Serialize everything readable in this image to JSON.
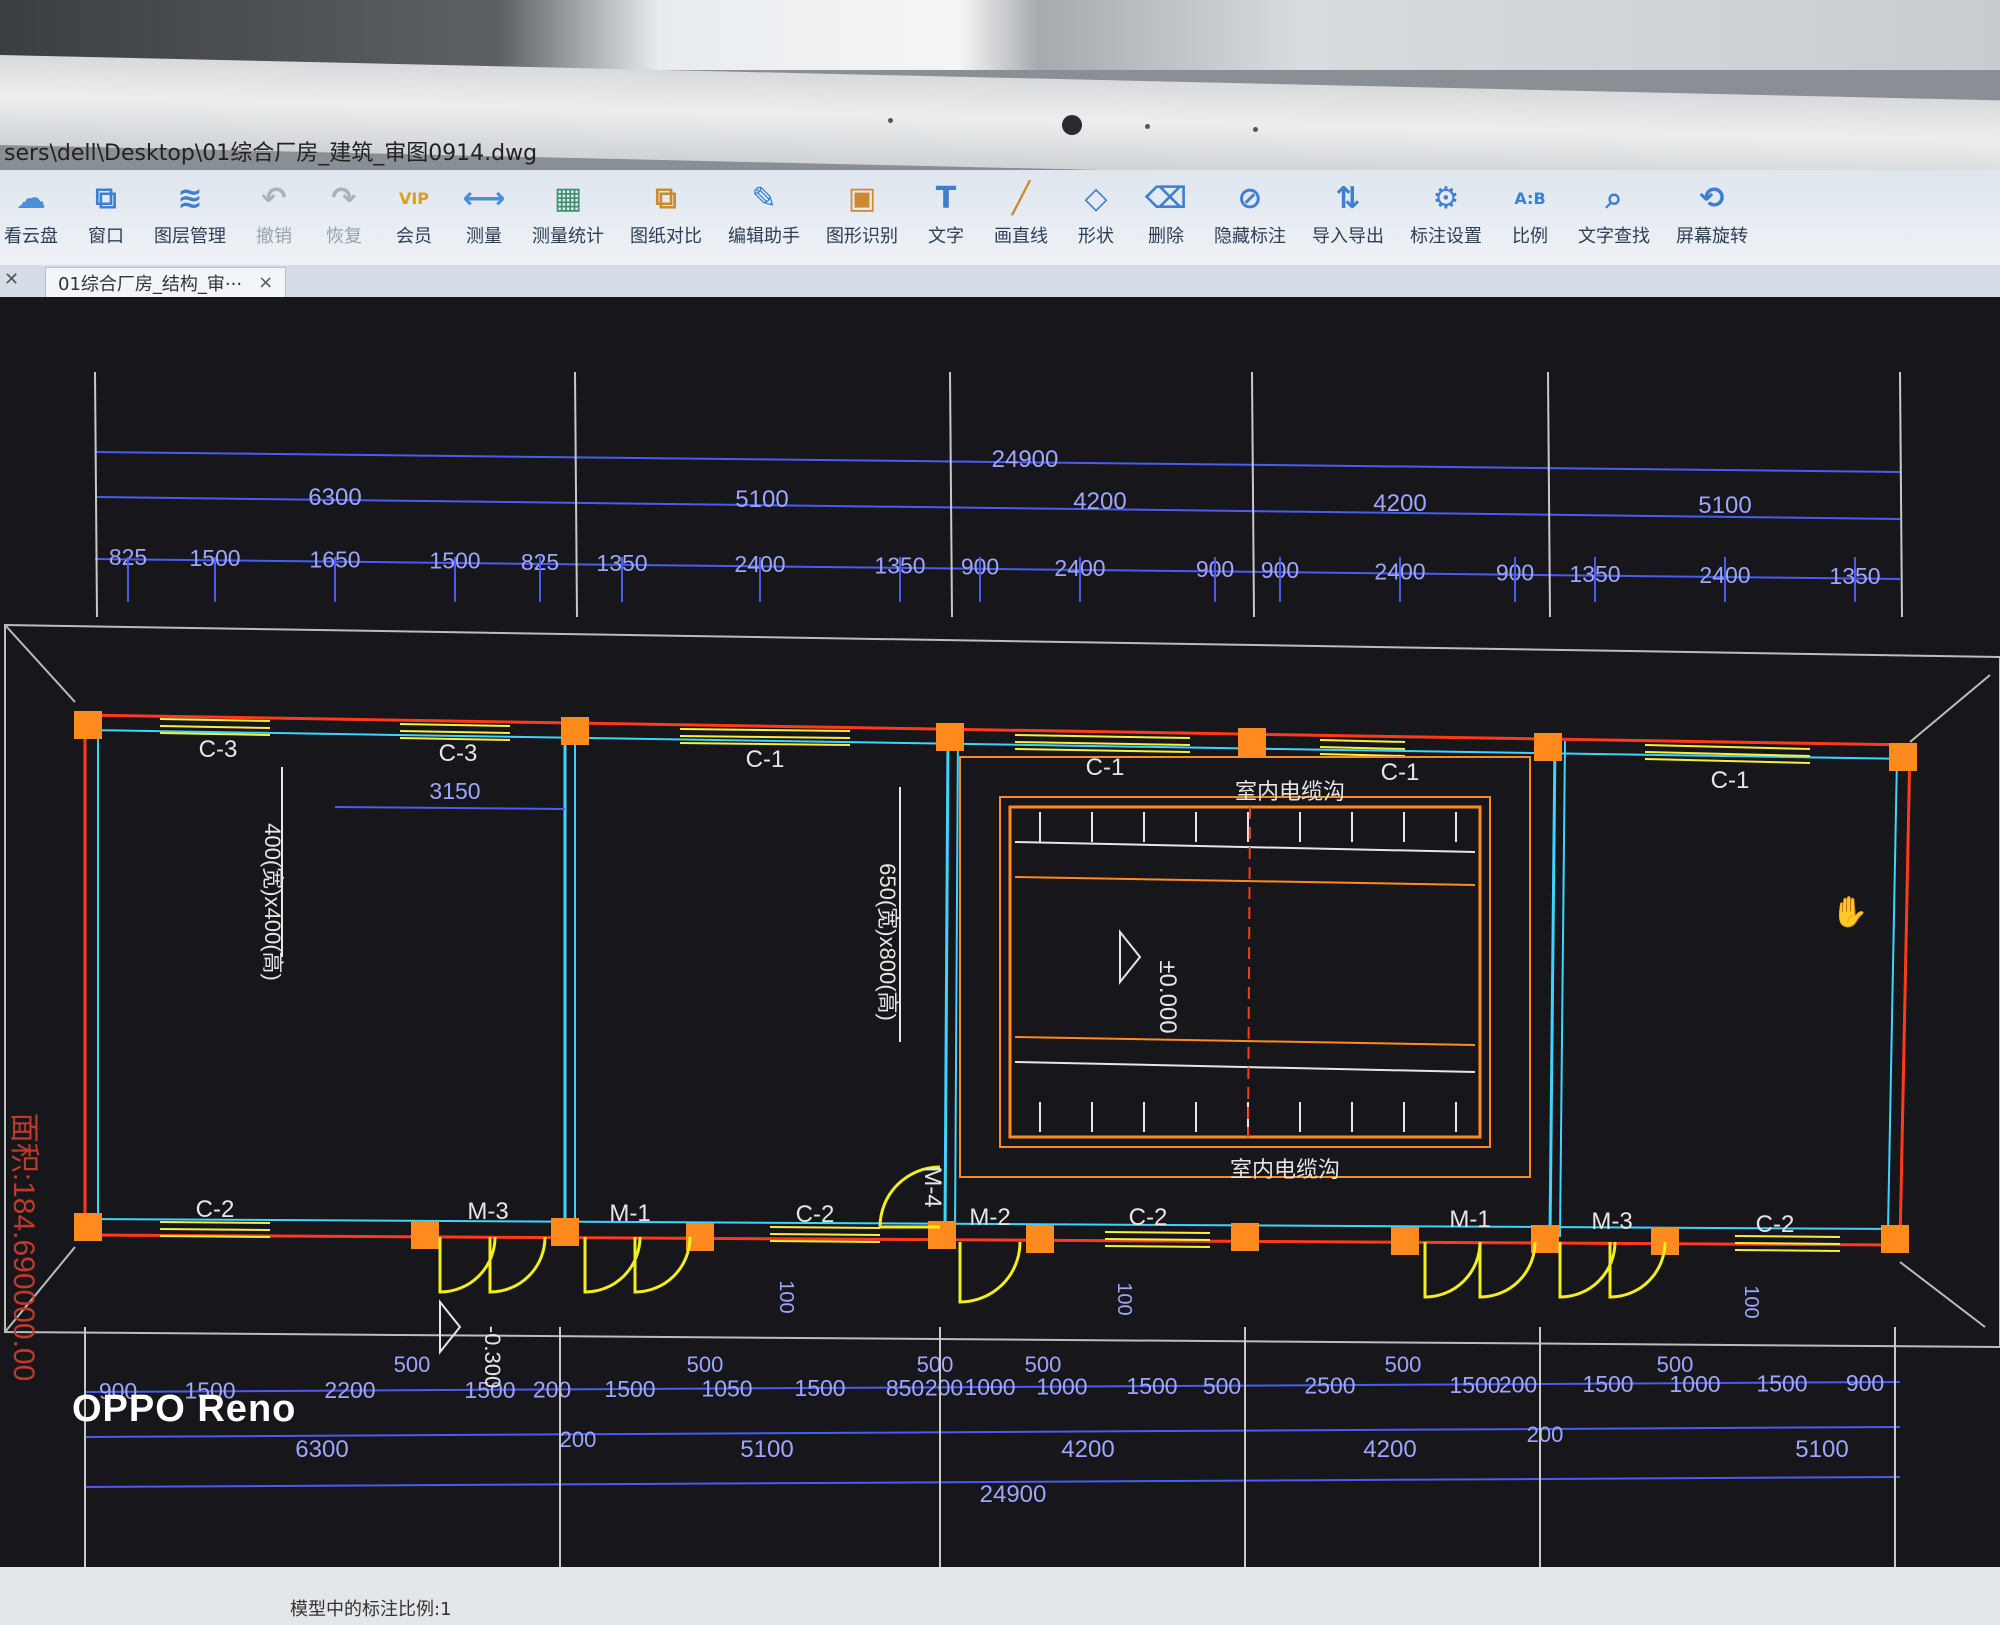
{
  "window": {
    "title_path": "sers\\dell\\Desktop\\01综合厂房_建筑_审图0914.dwg",
    "tab_label": "01综合厂房_结构_审···",
    "tab_close": "×"
  },
  "toolbar": [
    {
      "label": "看云盘",
      "icon": "cloud-icon",
      "color": "#4a8fd8"
    },
    {
      "label": "窗口",
      "icon": "window-icon",
      "color": "#3f7fd1"
    },
    {
      "label": "图层管理",
      "icon": "layers-icon",
      "color": "#3f7fd1"
    },
    {
      "label": "撤销",
      "icon": "undo-icon",
      "color": "#a9b2bc"
    },
    {
      "label": "恢复",
      "icon": "redo-icon",
      "color": "#a9b2bc"
    },
    {
      "label": "会员",
      "icon": "vip-icon",
      "color": "#d6a21c"
    },
    {
      "label": "测量",
      "icon": "measure-icon",
      "color": "#4a8fd8"
    },
    {
      "label": "测量统计",
      "icon": "measure-stats-icon",
      "color": "#3a8f6d"
    },
    {
      "label": "图纸对比",
      "icon": "compare-icon",
      "color": "#c98b2e"
    },
    {
      "label": "编辑助手",
      "icon": "edit-assistant-icon",
      "color": "#2f7fd8"
    },
    {
      "label": "图形识别",
      "icon": "shape-recognize-icon",
      "color": "#c98b2e"
    },
    {
      "label": "文字",
      "icon": "text-icon",
      "color": "#3f7fd1"
    },
    {
      "label": "画直线",
      "icon": "line-icon",
      "color": "#c98b2e"
    },
    {
      "label": "形状",
      "icon": "shape-icon",
      "color": "#3f7fd1"
    },
    {
      "label": "删除",
      "icon": "eraser-icon",
      "color": "#3f7fd1"
    },
    {
      "label": "隐藏标注",
      "icon": "hide-annotation-icon",
      "color": "#3f7fd1"
    },
    {
      "label": "导入导出",
      "icon": "import-export-icon",
      "color": "#3f7fd1"
    },
    {
      "label": "标注设置",
      "icon": "annotation-settings-icon",
      "color": "#3f7fd1"
    },
    {
      "label": "比例",
      "icon": "scale-icon",
      "color": "#3f7fd1"
    },
    {
      "label": "文字查找",
      "icon": "text-search-icon",
      "color": "#3f7fd1"
    },
    {
      "label": "屏幕旋转",
      "icon": "rotate-screen-icon",
      "color": "#3f7fd1"
    }
  ],
  "drawing": {
    "top_total": "24900",
    "top_bays": [
      "6300",
      "5100",
      "4200",
      "4200",
      "5100"
    ],
    "top_detail": [
      "825",
      "1500",
      "1650",
      "1500",
      "825",
      "1350",
      "2400",
      "1350",
      "900",
      "2400",
      "900",
      "900",
      "2400",
      "900",
      "1350",
      "2400",
      "1350"
    ],
    "bottom_detail": [
      "900",
      "1500",
      "2200",
      "1500",
      "200",
      "1500",
      "1050",
      "1500",
      "850",
      "200",
      "1000",
      "1000",
      "1500",
      "500",
      "2500",
      "1500",
      "200",
      "1500",
      "1000",
      "1500",
      "900"
    ],
    "bottom_small": [
      "500",
      "500",
      "500",
      "500",
      "500",
      "500"
    ],
    "bottom_200": [
      "200",
      "200"
    ],
    "bottom_bays": [
      "6300",
      "5100",
      "4200",
      "4200",
      "5100"
    ],
    "bottom_total": "24900",
    "window_labels_top": [
      "C-3",
      "C-3",
      "C-1",
      "C-1",
      "C-1",
      "C-1"
    ],
    "window_labels_bottom": [
      "C-2",
      "C-2",
      "C-2",
      "C-2"
    ],
    "door_labels": [
      "M-3",
      "M-1",
      "M-2",
      "M-1",
      "M-3",
      "M-4"
    ],
    "dim_3150": "3150",
    "opening_note_1": "400(宽)x400(高)",
    "opening_note_2": "650(宽)x800(高)",
    "elevation": "±0.000",
    "outdoor_elevation": "-0.300",
    "cable_trench_top": "室内电缆沟",
    "cable_trench_bottom": "室内电缆沟",
    "area_text": "面积:184.690000.00",
    "small_tags": [
      "100",
      "100",
      "100"
    ]
  },
  "status": {
    "text": "模型中的标注比例:1"
  },
  "photo": {
    "watermark": "OPPO Reno"
  },
  "colors": {
    "canvas_bg": "#17161b",
    "dimension": "#4a5cf0",
    "dimension_text": "#9fa6ff",
    "wall_cyan": "#3fd4ff",
    "wall_red": "#ff3a1a",
    "column": "#ff8a1e",
    "window_yellow": "#f6ef3c",
    "door_yellow": "#f1ef20",
    "text_white": "#e6e6e6",
    "area_red": "#c0392b"
  }
}
